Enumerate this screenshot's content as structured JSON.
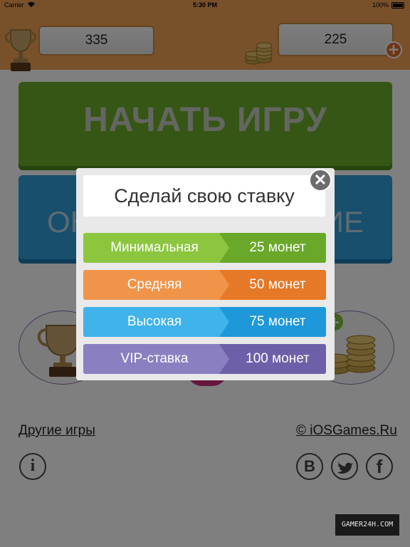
{
  "status_bar": {
    "carrier": "Carrier",
    "time": "5:30 PM",
    "battery": "100%"
  },
  "header": {
    "score": "335",
    "coins": "225",
    "plus": "+"
  },
  "menu": {
    "start_label": "НАЧАТЬ ИГРУ",
    "info_label_left": "ОН",
    "info_label_right": "ИЕ",
    "other_games": "Другие игры",
    "copyright": "© iOSGames.Ru",
    "vk": "В",
    "facebook": "f",
    "info": "i"
  },
  "modal": {
    "title": "Сделай свою ставку",
    "close": "✕",
    "bets": [
      {
        "name": "Минимальная",
        "amount": "25 монет",
        "name_color": "#8cc63f",
        "amount_color": "#6aa82a"
      },
      {
        "name": "Средняя",
        "amount": "50 монет",
        "name_color": "#f0944a",
        "amount_color": "#e57928"
      },
      {
        "name": "Высокая",
        "amount": "75 монет",
        "name_color": "#3fb3ea",
        "amount_color": "#1e98d8"
      },
      {
        "name": "VIP-ставка",
        "amount": "100 монет",
        "name_color": "#8a7fc0",
        "amount_color": "#6d5fa8"
      }
    ]
  },
  "watermark": "GAMER24H.COM"
}
